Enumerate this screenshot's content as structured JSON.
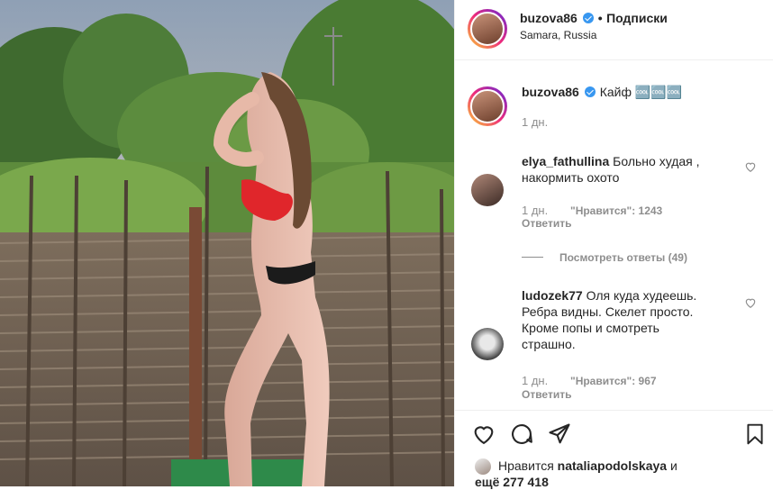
{
  "post": {
    "username": "buzova86",
    "follow_label": "Подписки",
    "location": "Samara, Russia"
  },
  "caption": {
    "username": "buzova86",
    "text": "Кайф 🆒🆒🆒",
    "time": "1 дн."
  },
  "comments": [
    {
      "username": "elya_fathullina",
      "text_line1": "Больно худая ,",
      "text_line2": "накормить охото",
      "time": "1 дн.",
      "likes": "\"Нравится\": 1243",
      "reply": "Ответить"
    },
    {
      "username": "ludozek77",
      "text_line1": "Оля куда худеешь.",
      "text_line2": "Ребра видны. Скелет просто.",
      "text_line3": "Кроме попы и смотреть",
      "text_line4": "страшно.",
      "time": "1 дн.",
      "likes": "\"Нравится\": 967",
      "reply": "Ответить"
    }
  ],
  "view_replies": "Посмотреть ответы (49)",
  "likes_line": {
    "prefix": "Нравится",
    "user": "nataliapodolskaya",
    "suffix": "и",
    "others": "ещё 277 418"
  },
  "icons": [
    "heart-icon",
    "comment-icon",
    "share-icon",
    "bookmark-icon",
    "verified-icon"
  ],
  "colors": {
    "verified": "#3897f0",
    "text": "#262626",
    "muted": "#8e8e8e"
  }
}
